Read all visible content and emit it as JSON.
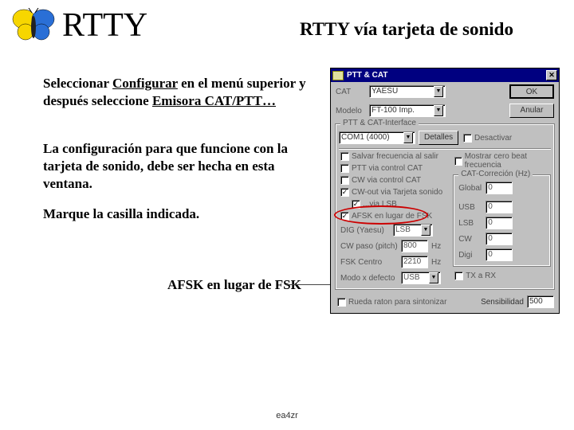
{
  "header": {
    "main_title": "RTTY",
    "right_title": "RTTY vía tarjeta de sonido"
  },
  "paragraphs": {
    "p1a": "Seleccionar ",
    "p1b": "Configurar",
    "p1c": " en el menú superior y después seleccione ",
    "p1d": "Emisora CAT/PTT…",
    "p2": "La configuración para que funcione con la  tarjeta de sonido, debe ser hecha en esta ventana.",
    "p3": "Marque la casilla indicada."
  },
  "afsk_label": "AFSK en lugar de FSK",
  "footer": "ea4zr",
  "dialog": {
    "title": "PTT & CAT",
    "close": "✕",
    "cat_label": "CAT",
    "cat_value": "YAESU",
    "modelo_label": "Modelo",
    "modelo_value": "FT-100 Imp.",
    "btn_ok": "OK",
    "btn_anular": "Anular",
    "group_ptt": "PTT & CAT-Interface",
    "com_value": "COM1 (4000)",
    "btn_detalles": "Detalles",
    "chk_desactivar": "Desactivar",
    "chk_salvar": "Salvar frecuencia al salir",
    "chk_mostrar": "Mostrar cero beat frecuencia",
    "chk_ptt_cat": "PTT via control CAT",
    "chk_cw_cat": "CW via control CAT",
    "chk_cw_out": "CW-out via Tarjeta sonido",
    "chk_via_lsb": "...via LSB",
    "chk_afsk": "AFSK en lugar de FSK",
    "group_cat_corr": "CAT-Correción (Hz)",
    "lbl_global": "Global",
    "val_global": "0",
    "lbl_usb": "USB",
    "val_usb": "0",
    "lbl_lsb": "LSB",
    "val_lsb": "0",
    "lbl_cw": "CW",
    "val_cw": "0",
    "lbl_digi": "Digi",
    "val_digi": "0",
    "lbl_dig_yaesu": "DIG (Yaesu)",
    "val_dig_yaesu": "LSB",
    "lbl_cw_paso": "CW paso (pitch)",
    "val_cw_paso": "800",
    "unit_hz": "Hz",
    "lbl_fsk_centro": "FSK Centro",
    "val_fsk_centro": "2210",
    "lbl_modo_def": "Modo x defecto",
    "val_modo_def": "USB",
    "chk_tx_rx": "TX a RX",
    "chk_rueda": "Rueda raton para sintonizar",
    "lbl_sensibilidad": "Sensibilidad",
    "val_sensibilidad": "500"
  }
}
